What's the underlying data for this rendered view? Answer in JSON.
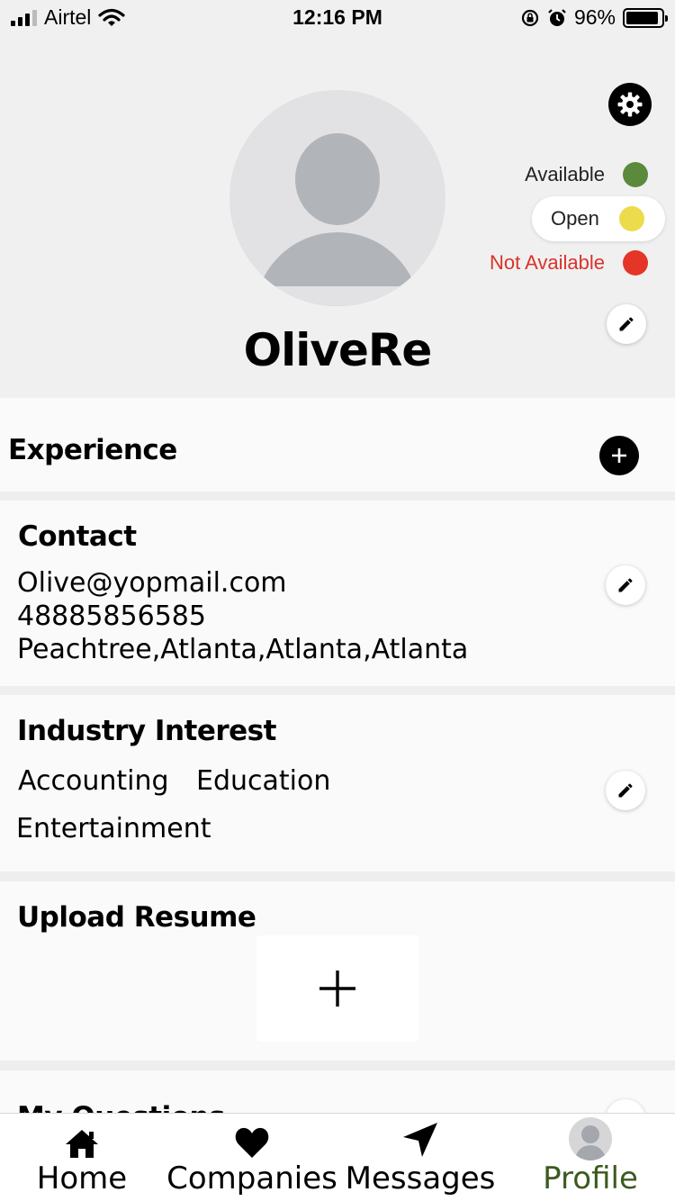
{
  "status_bar": {
    "carrier": "Airtel",
    "time": "12:16 PM",
    "battery": "96%"
  },
  "profile": {
    "username": "OliveRe",
    "availability": [
      {
        "label": "Available",
        "color": "#5b8a3c",
        "selected": false
      },
      {
        "label": "Open",
        "color": "#ecdb4b",
        "selected": true
      },
      {
        "label": "Not Available",
        "color": "#e53527",
        "selected": false
      }
    ]
  },
  "sections": {
    "experience": {
      "title": "Experience"
    },
    "contact": {
      "title": "Contact",
      "email": "Olive@yopmail.com",
      "phone": "48885856585",
      "address": "Peachtree,Atlanta,Atlanta,Atlanta"
    },
    "industry": {
      "title": "Industry Interest",
      "items": [
        "Accounting",
        "Education",
        "Entertainment"
      ]
    },
    "resume": {
      "title": "Upload Resume"
    },
    "questions": {
      "title": "My Questions"
    }
  },
  "tabbar": {
    "tabs": [
      {
        "label": "Home",
        "icon": "home-icon"
      },
      {
        "label": "Companies",
        "icon": "heart-icon"
      },
      {
        "label": "Messages",
        "icon": "send-icon"
      },
      {
        "label": "Profile",
        "icon": "avatar-icon"
      }
    ],
    "active_color": "#3d5a1f"
  }
}
